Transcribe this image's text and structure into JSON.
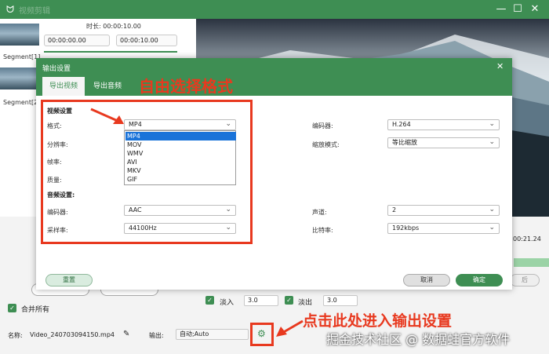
{
  "titlebar": {
    "title": "视频剪辑",
    "app_icon": "rabbit-icon",
    "controls": [
      "minimize-icon",
      "maximize-icon",
      "close-icon"
    ]
  },
  "segments": {
    "duration_label": "时长: 00:00:10.00",
    "start_time": "00:00:00.00",
    "end_time": "00:00:10.00",
    "items": [
      {
        "label": "Segment[1]"
      },
      {
        "label": "Segment[2]"
      }
    ]
  },
  "preview": {
    "time_readout": "00:21.24",
    "partial_button": "后"
  },
  "dialog": {
    "title": "输出设置",
    "tabs": [
      {
        "label": "导出视频",
        "active": true
      },
      {
        "label": "导出音频",
        "active": false
      }
    ],
    "video": {
      "section_title": "视频设置",
      "format_label": "格式:",
      "format_value": "MP4",
      "resolution_label": "分辨率:",
      "framerate_label": "帧率:",
      "quality_label": "质量:",
      "encoder_label": "编码器:",
      "encoder_value": "H.264",
      "zoom_label": "缩放模式:",
      "zoom_value": "等比缩放"
    },
    "format_options": [
      "MP4",
      "MOV",
      "WMV",
      "AVI",
      "MKV",
      "GIF"
    ],
    "audio": {
      "section_title": "音频设置:",
      "encoder_label": "编码器:",
      "encoder_value": "AAC",
      "samplerate_label": "采样率:",
      "samplerate_value": "44100Hz",
      "channel_label": "声道:",
      "channel_value": "2",
      "bitrate_label": "比特率:",
      "bitrate_value": "192kbps"
    },
    "reset_label": "重置",
    "cancel_label": "取消",
    "ok_label": "确定"
  },
  "bottom": {
    "merge_label": "合并所有",
    "fade_in_label": "淡入",
    "fade_in_value": "3.0",
    "fade_out_label": "淡出",
    "fade_out_value": "3.0",
    "name_label": "名称:",
    "name_value": "Video_240703094150.mp4",
    "output_label": "输出:",
    "output_value": "自动;Auto"
  },
  "annotations": {
    "free_format": "自由选择格式",
    "click_here": "点击此处进入输出设置",
    "watermark": "掘金技术社区 @ 数据蛙官方软件"
  },
  "colors": {
    "accent": "#3e8e53",
    "annotation_red": "#e8391f",
    "selection_blue": "#1a73d9"
  }
}
